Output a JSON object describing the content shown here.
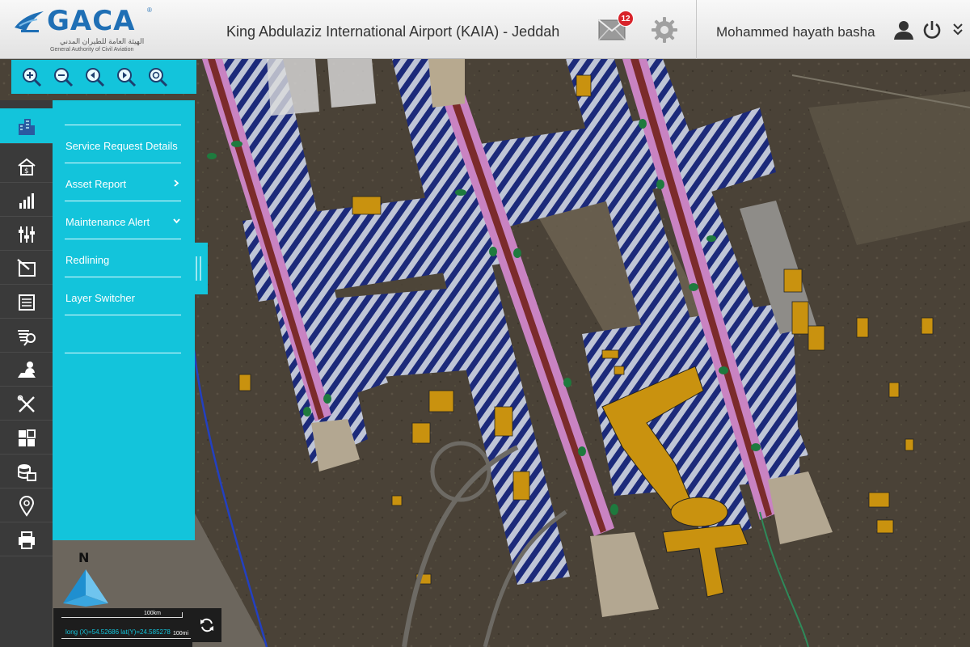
{
  "header": {
    "logo_text": "GACA",
    "logo_registered": "®",
    "logo_arabic": "الهيئة العامة للطيران المدني",
    "logo_english": "General Authority of Civil Aviation",
    "airport_title": "King Abdulaziz International Airport (KAIA) - Jeddah",
    "mail_count": "12",
    "user_name": "Mohammed  hayath basha",
    "icons": [
      "mail-icon",
      "settings-gear-icon",
      "user-icon",
      "power-icon",
      "double-chevron-down-icon"
    ]
  },
  "zoom_toolbar": {
    "buttons": [
      "zoom-in-icon",
      "zoom-out-icon",
      "previous-extent-icon",
      "next-extent-icon",
      "full-extent-icon"
    ]
  },
  "sidebar": {
    "active_index": 0,
    "items": [
      "buildings-icon",
      "asset-value-icon",
      "chart-icon",
      "sliders-icon",
      "redline-icon",
      "list-icon",
      "layers-search-icon",
      "person-map-icon",
      "tools-icon",
      "grid-icon",
      "database-report-icon",
      "location-pin-icon",
      "print-icon"
    ]
  },
  "panel": {
    "items": [
      {
        "label": "Service Request Details",
        "chevron": ""
      },
      {
        "label": "Asset Report",
        "chevron": "right"
      },
      {
        "label": "Maintenance  Alert",
        "chevron": "down"
      },
      {
        "label": "Redlining",
        "chevron": ""
      },
      {
        "label": "Layer Switcher",
        "chevron": ""
      },
      {
        "label": "",
        "chevron": ""
      }
    ]
  },
  "map": {
    "north_label": "N",
    "scale_top": "100km",
    "scale_bottom": "100mi",
    "coordinates": "long (X)=54.52686  lat(Y)=24.585278"
  },
  "colors": {
    "accent": "#13c4db",
    "header_bg": "#ebebeb",
    "rail_bg": "#3a3a3a",
    "mail_badge": "#d8232a",
    "building_fill": "#c9920f"
  }
}
